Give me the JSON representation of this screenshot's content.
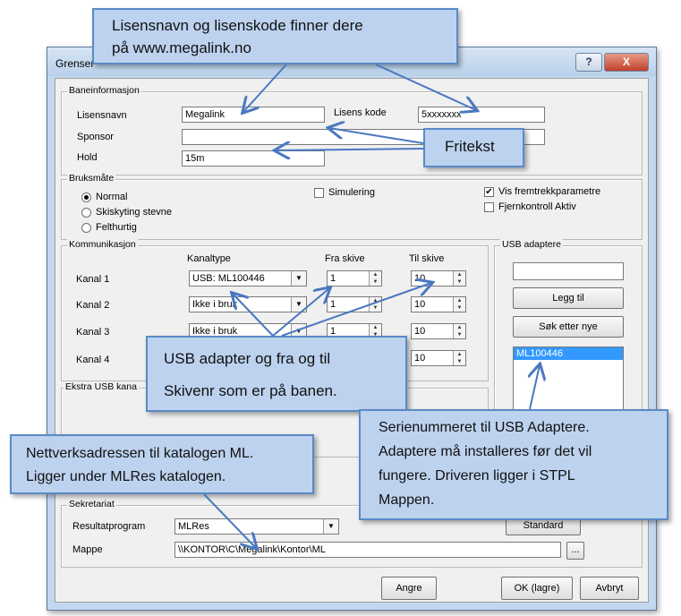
{
  "window": {
    "title": "Grenser",
    "help_label": "?",
    "close_label": "X"
  },
  "baneinfo": {
    "legend": "Baneinformasjon",
    "lisensnavn_label": "Lisensnavn",
    "lisensnavn_value": "Megalink",
    "lisenskode_label": "Lisens kode",
    "lisenskode_value": "5xxxxxxx",
    "sponsor_label": "Sponsor",
    "sponsor_value": "",
    "hold_label": "Hold",
    "hold_value": "15m"
  },
  "bruksmate": {
    "legend": "Bruksmåte",
    "modes": [
      "Normal",
      "Skiskyting stevne",
      "Felthurtig"
    ],
    "selected": "Normal",
    "simulering_label": "Simulering",
    "vis_label": "Vis fremtrekkparametre",
    "fjern_label": "Fjernkontroll Aktiv"
  },
  "kommunikasjon": {
    "legend": "Kommunikasjon",
    "col_kanaltype": "Kanaltype",
    "col_fra": "Fra skive",
    "col_til": "Til skive",
    "rows": [
      {
        "label": "Kanal 1",
        "kanaltype": "USB: ML100446",
        "fra": "1",
        "til": "10"
      },
      {
        "label": "Kanal 2",
        "kanaltype": "Ikke i bruk",
        "fra": "1",
        "til": "10"
      },
      {
        "label": "Kanal 3",
        "kanaltype": "Ikke i bruk",
        "fra": "1",
        "til": "10"
      },
      {
        "label": "Kanal 4",
        "kanaltype": "",
        "fra": "",
        "til": "10"
      }
    ]
  },
  "usb": {
    "legend": "USB adaptere",
    "input_value": "",
    "add_label": "Legg til",
    "search_label": "Søk etter nye",
    "list": [
      "ML100446"
    ]
  },
  "ekstra": {
    "legend": "Ekstra USB kana"
  },
  "sekretariat": {
    "legend": "Sekretariat",
    "resultat_label": "Resultatprogram",
    "resultat_value": "MLRes",
    "standard_label": "Standard",
    "mappe_label": "Mappe",
    "mappe_value": "\\\\KONTOR\\C\\Megalink\\Kontor\\ML",
    "browse_label": "..."
  },
  "footer": {
    "angre": "Angre",
    "ok": "OK (lagre)",
    "avbryt": "Avbryt"
  },
  "callouts": {
    "top": [
      "Lisensnavn  og lisenskode  finner dere",
      "på www.megalink.no"
    ],
    "fritekst": "Fritekst",
    "usb": [
      "USB adapter og fra og til",
      "Skivenr som er på banen."
    ],
    "serie": [
      "Serienummeret til USB Adaptere.",
      "Adaptere må installeres før det vil",
      "fungere. Driveren ligger i STPL",
      "Mappen."
    ],
    "nett": [
      "Nettverksadressen  til katalogen ML.",
      "Ligger under MLRes  katalogen."
    ]
  },
  "colors": {
    "callout_fill": "#bcd2ee",
    "callout_border": "#5a8ac6",
    "arrow": "#4a78c0",
    "selected_list": "#3399ff"
  }
}
